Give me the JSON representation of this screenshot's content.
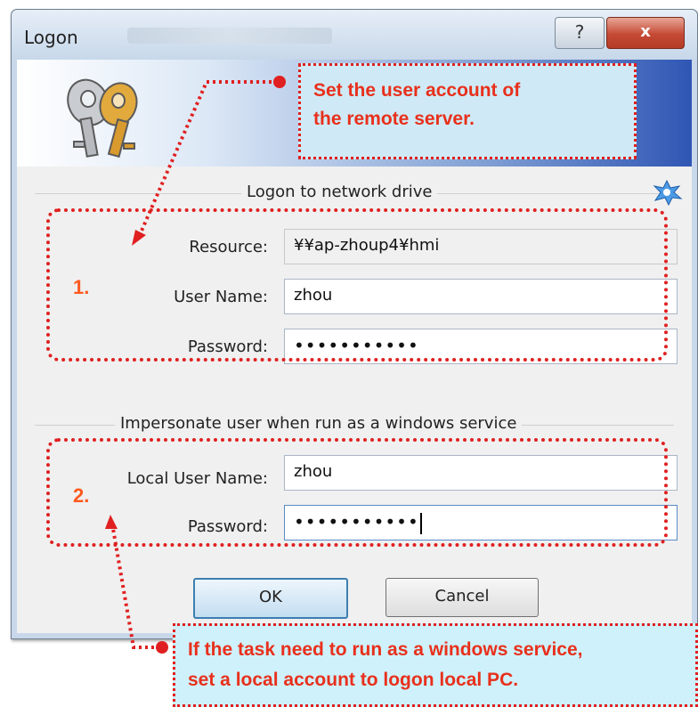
{
  "window": {
    "title": "Logon",
    "help_glyph": "?",
    "close_glyph": "x"
  },
  "banner": {
    "icon": "keys-icon",
    "callout_line1": "Set the user account of",
    "callout_line2": "the remote server."
  },
  "network_group": {
    "title": "Logon to network drive",
    "step": "1.",
    "resource_label": "Resource:",
    "resource_value": "¥¥ap-zhoup4¥hmi",
    "username_label": "User Name:",
    "username_value": "zhou",
    "password_label": "Password:",
    "password_value": "•••••••••••"
  },
  "service_group": {
    "title": "Impersonate user when run as a windows service",
    "step": "2.",
    "local_username_label": "Local User Name:",
    "local_username_value": "zhou",
    "password_label": "Password:",
    "password_value": "•••••••••••"
  },
  "buttons": {
    "ok": "OK",
    "cancel": "Cancel"
  },
  "bottom_callout": {
    "line1": "If the task need to run as a windows service,",
    "line2": "set a local account to logon local PC."
  },
  "colors": {
    "annotation_red": "#e02020",
    "callout_fill": "#cff1fb",
    "step_orange": "#ff5a1f"
  }
}
